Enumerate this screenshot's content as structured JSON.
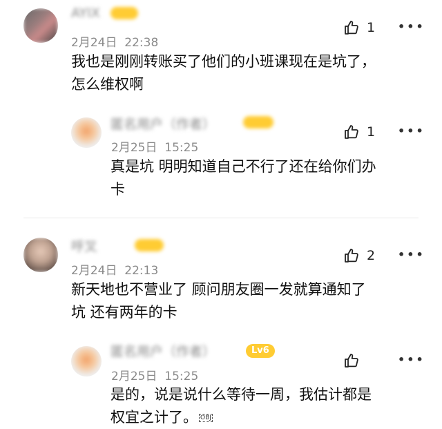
{
  "comments": [
    {
      "username": "AYIX",
      "badge": "",
      "date": "2月24日",
      "time": "22:38",
      "likes": "1",
      "text_lines": [
        "我也是刚刚转账买了他们的小班课现在是坑了，",
        "怎么维权啊"
      ],
      "reply": {
        "username": "匿名用户（作者）",
        "badge": "",
        "date": "2月25日",
        "time": "15:25",
        "likes": "1",
        "text_lines": [
          "真是坑 明明知道自己不行了还在给你们办",
          "卡"
        ]
      }
    },
    {
      "username": "呼叉",
      "badge": "",
      "date": "2月24日",
      "time": "22:13",
      "likes": "2",
      "text_lines": [
        "新天地也不营业了 顾问朋友圈一发就算通知了",
        "坑 还有两年的卡"
      ],
      "reply": {
        "username": "匿名用户（作者）",
        "badge": "Lv6",
        "date": "2月25日",
        "time": "15:25",
        "likes": "",
        "text_lines": [
          "是的，说是说什么等待一周，我估计都是",
          "权宜之计了。"
        ],
        "obj_marker": "OBJ"
      }
    }
  ],
  "icons": {
    "like": "thumbs-up-icon",
    "more": "more-dots-icon"
  },
  "colors": {
    "badge": "#ffcc33",
    "meta_gray": "#8a8a8a",
    "divider": "#e8e8e8"
  }
}
